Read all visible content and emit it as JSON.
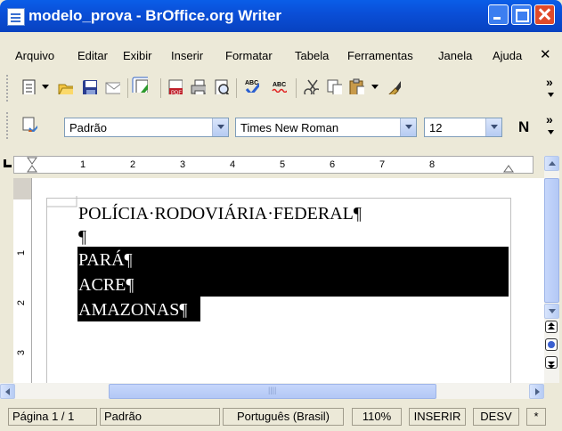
{
  "window": {
    "title": "modelo_prova - BrOffice.org Writer"
  },
  "menu": {
    "items": [
      "Arquivo",
      "Editar",
      "Exibir",
      "Inserir",
      "Formatar",
      "Tabela",
      "Ferramentas",
      "Janela",
      "Ajuda"
    ],
    "close_glyph": "✕"
  },
  "toolbar": {
    "more_glyph": "»"
  },
  "format_toolbar": {
    "paragraph_style": "Padrão",
    "font_name": "Times New Roman",
    "font_size": "12",
    "bold_label": "N"
  },
  "ruler": {
    "numbers": [
      "1",
      "2",
      "3",
      "4",
      "5",
      "6",
      "7",
      "8"
    ]
  },
  "vruler": {
    "numbers": [
      "1",
      "2",
      "3"
    ]
  },
  "document": {
    "lines": [
      "POLÍCIA·RODOVIÁRIA·FEDERAL¶",
      "¶",
      "PARÁ¶",
      "ACRE¶",
      "AMAZONAS¶"
    ]
  },
  "statusbar": {
    "page": "Página 1 / 1",
    "style": "Padrão",
    "language": "Português (Brasil)",
    "zoom": "110%",
    "insert_mode": "INSERIR",
    "selection_mode": "DESV",
    "modified": "*"
  },
  "hscroll": {
    "grip": "||||"
  },
  "colors": {
    "title_bar": "#0a54e0",
    "selection": "#000000",
    "toolbar_bg": "#ece9d8"
  }
}
